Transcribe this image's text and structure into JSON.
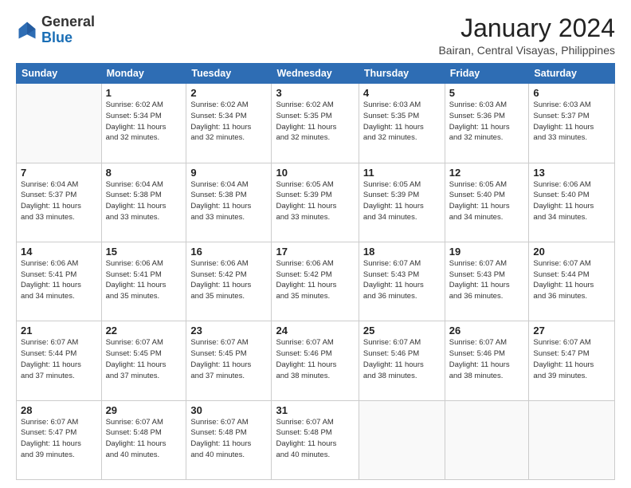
{
  "logo": {
    "general": "General",
    "blue": "Blue"
  },
  "title": "January 2024",
  "subtitle": "Bairan, Central Visayas, Philippines",
  "weekdays": [
    "Sunday",
    "Monday",
    "Tuesday",
    "Wednesday",
    "Thursday",
    "Friday",
    "Saturday"
  ],
  "weeks": [
    [
      {
        "day": "",
        "sunrise": "",
        "sunset": "",
        "daylight": ""
      },
      {
        "day": "1",
        "sunrise": "Sunrise: 6:02 AM",
        "sunset": "Sunset: 5:34 PM",
        "daylight": "Daylight: 11 hours and 32 minutes."
      },
      {
        "day": "2",
        "sunrise": "Sunrise: 6:02 AM",
        "sunset": "Sunset: 5:34 PM",
        "daylight": "Daylight: 11 hours and 32 minutes."
      },
      {
        "day": "3",
        "sunrise": "Sunrise: 6:02 AM",
        "sunset": "Sunset: 5:35 PM",
        "daylight": "Daylight: 11 hours and 32 minutes."
      },
      {
        "day": "4",
        "sunrise": "Sunrise: 6:03 AM",
        "sunset": "Sunset: 5:35 PM",
        "daylight": "Daylight: 11 hours and 32 minutes."
      },
      {
        "day": "5",
        "sunrise": "Sunrise: 6:03 AM",
        "sunset": "Sunset: 5:36 PM",
        "daylight": "Daylight: 11 hours and 32 minutes."
      },
      {
        "day": "6",
        "sunrise": "Sunrise: 6:03 AM",
        "sunset": "Sunset: 5:37 PM",
        "daylight": "Daylight: 11 hours and 33 minutes."
      }
    ],
    [
      {
        "day": "7",
        "sunrise": "Sunrise: 6:04 AM",
        "sunset": "Sunset: 5:37 PM",
        "daylight": "Daylight: 11 hours and 33 minutes."
      },
      {
        "day": "8",
        "sunrise": "Sunrise: 6:04 AM",
        "sunset": "Sunset: 5:38 PM",
        "daylight": "Daylight: 11 hours and 33 minutes."
      },
      {
        "day": "9",
        "sunrise": "Sunrise: 6:04 AM",
        "sunset": "Sunset: 5:38 PM",
        "daylight": "Daylight: 11 hours and 33 minutes."
      },
      {
        "day": "10",
        "sunrise": "Sunrise: 6:05 AM",
        "sunset": "Sunset: 5:39 PM",
        "daylight": "Daylight: 11 hours and 33 minutes."
      },
      {
        "day": "11",
        "sunrise": "Sunrise: 6:05 AM",
        "sunset": "Sunset: 5:39 PM",
        "daylight": "Daylight: 11 hours and 34 minutes."
      },
      {
        "day": "12",
        "sunrise": "Sunrise: 6:05 AM",
        "sunset": "Sunset: 5:40 PM",
        "daylight": "Daylight: 11 hours and 34 minutes."
      },
      {
        "day": "13",
        "sunrise": "Sunrise: 6:06 AM",
        "sunset": "Sunset: 5:40 PM",
        "daylight": "Daylight: 11 hours and 34 minutes."
      }
    ],
    [
      {
        "day": "14",
        "sunrise": "Sunrise: 6:06 AM",
        "sunset": "Sunset: 5:41 PM",
        "daylight": "Daylight: 11 hours and 34 minutes."
      },
      {
        "day": "15",
        "sunrise": "Sunrise: 6:06 AM",
        "sunset": "Sunset: 5:41 PM",
        "daylight": "Daylight: 11 hours and 35 minutes."
      },
      {
        "day": "16",
        "sunrise": "Sunrise: 6:06 AM",
        "sunset": "Sunset: 5:42 PM",
        "daylight": "Daylight: 11 hours and 35 minutes."
      },
      {
        "day": "17",
        "sunrise": "Sunrise: 6:06 AM",
        "sunset": "Sunset: 5:42 PM",
        "daylight": "Daylight: 11 hours and 35 minutes."
      },
      {
        "day": "18",
        "sunrise": "Sunrise: 6:07 AM",
        "sunset": "Sunset: 5:43 PM",
        "daylight": "Daylight: 11 hours and 36 minutes."
      },
      {
        "day": "19",
        "sunrise": "Sunrise: 6:07 AM",
        "sunset": "Sunset: 5:43 PM",
        "daylight": "Daylight: 11 hours and 36 minutes."
      },
      {
        "day": "20",
        "sunrise": "Sunrise: 6:07 AM",
        "sunset": "Sunset: 5:44 PM",
        "daylight": "Daylight: 11 hours and 36 minutes."
      }
    ],
    [
      {
        "day": "21",
        "sunrise": "Sunrise: 6:07 AM",
        "sunset": "Sunset: 5:44 PM",
        "daylight": "Daylight: 11 hours and 37 minutes."
      },
      {
        "day": "22",
        "sunrise": "Sunrise: 6:07 AM",
        "sunset": "Sunset: 5:45 PM",
        "daylight": "Daylight: 11 hours and 37 minutes."
      },
      {
        "day": "23",
        "sunrise": "Sunrise: 6:07 AM",
        "sunset": "Sunset: 5:45 PM",
        "daylight": "Daylight: 11 hours and 37 minutes."
      },
      {
        "day": "24",
        "sunrise": "Sunrise: 6:07 AM",
        "sunset": "Sunset: 5:46 PM",
        "daylight": "Daylight: 11 hours and 38 minutes."
      },
      {
        "day": "25",
        "sunrise": "Sunrise: 6:07 AM",
        "sunset": "Sunset: 5:46 PM",
        "daylight": "Daylight: 11 hours and 38 minutes."
      },
      {
        "day": "26",
        "sunrise": "Sunrise: 6:07 AM",
        "sunset": "Sunset: 5:46 PM",
        "daylight": "Daylight: 11 hours and 38 minutes."
      },
      {
        "day": "27",
        "sunrise": "Sunrise: 6:07 AM",
        "sunset": "Sunset: 5:47 PM",
        "daylight": "Daylight: 11 hours and 39 minutes."
      }
    ],
    [
      {
        "day": "28",
        "sunrise": "Sunrise: 6:07 AM",
        "sunset": "Sunset: 5:47 PM",
        "daylight": "Daylight: 11 hours and 39 minutes."
      },
      {
        "day": "29",
        "sunrise": "Sunrise: 6:07 AM",
        "sunset": "Sunset: 5:48 PM",
        "daylight": "Daylight: 11 hours and 40 minutes."
      },
      {
        "day": "30",
        "sunrise": "Sunrise: 6:07 AM",
        "sunset": "Sunset: 5:48 PM",
        "daylight": "Daylight: 11 hours and 40 minutes."
      },
      {
        "day": "31",
        "sunrise": "Sunrise: 6:07 AM",
        "sunset": "Sunset: 5:48 PM",
        "daylight": "Daylight: 11 hours and 40 minutes."
      },
      {
        "day": "",
        "sunrise": "",
        "sunset": "",
        "daylight": ""
      },
      {
        "day": "",
        "sunrise": "",
        "sunset": "",
        "daylight": ""
      },
      {
        "day": "",
        "sunrise": "",
        "sunset": "",
        "daylight": ""
      }
    ]
  ]
}
